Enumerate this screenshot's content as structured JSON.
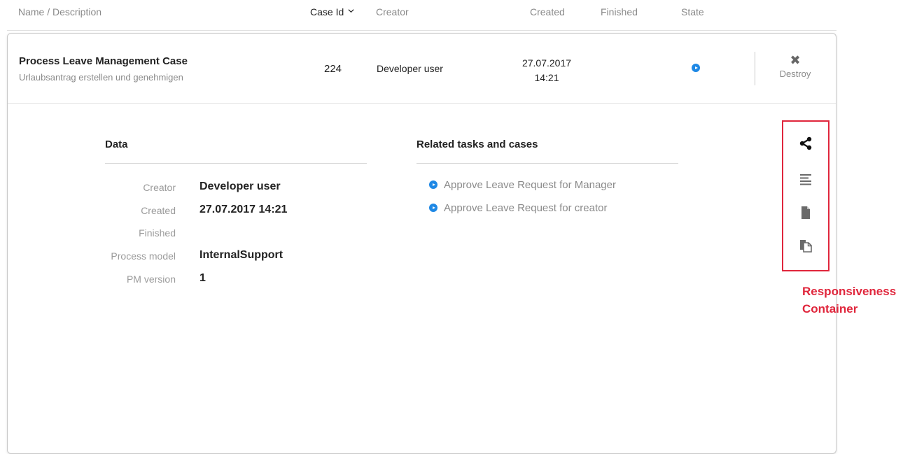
{
  "header": {
    "name_desc": "Name / Description",
    "case_id": "Case Id",
    "creator": "Creator",
    "created": "Created",
    "finished": "Finished",
    "state": "State"
  },
  "case": {
    "title": "Process Leave Management Case",
    "description": "Urlaubsantrag erstellen und genehmigen",
    "id": "224",
    "creator": "Developer user",
    "created_date": "27.07.2017",
    "created_time": "14:21",
    "state_color": "#1e88e5",
    "destroy_label": "Destroy"
  },
  "details": {
    "data_title": "Data",
    "creator_label": "Creator",
    "creator_value": "Developer user",
    "created_label": "Created",
    "created_value": "27.07.2017 14:21",
    "finished_label": "Finished",
    "finished_value": "",
    "process_model_label": "Process model",
    "process_model_value": "InternalSupport",
    "pm_version_label": "PM version",
    "pm_version_value": "1"
  },
  "related": {
    "title": "Related tasks and cases",
    "items": [
      "Approve Leave Request for Manager",
      "Approve Leave Request for creator"
    ]
  },
  "side_icons": [
    "share-icon",
    "text-lines-icon",
    "document-icon",
    "copy-document-icon"
  ],
  "annotation": {
    "line1": "Responsiveness",
    "line2": "Container",
    "color": "#e0263c"
  }
}
